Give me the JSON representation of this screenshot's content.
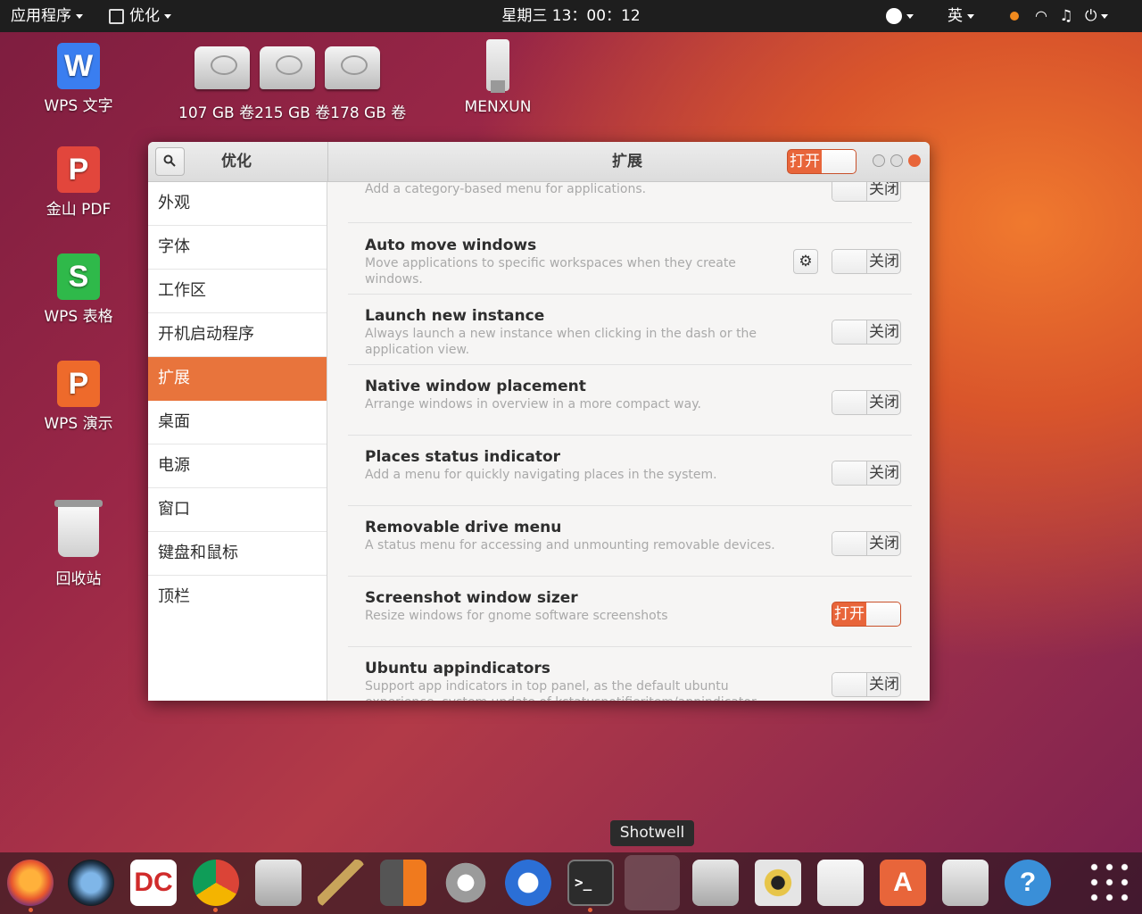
{
  "topbar": {
    "apps_menu": "应用程序",
    "active_app": "优化",
    "clock": "星期三 13：00：12",
    "input_method": "英"
  },
  "desktop": {
    "wps_writer": "WPS 文字",
    "pdf": "金山 PDF",
    "wps_sheets": "WPS 表格",
    "wps_present": "WPS 演示",
    "trash": "回收站",
    "drives": "107 GB 卷215 GB 卷178 GB 卷",
    "usb": "MENXUN"
  },
  "window": {
    "sidebar_title": "优化",
    "page_title": "扩展",
    "master_switch": "打开",
    "sidebar_items": [
      "外观",
      "字体",
      "工作区",
      "开机启动程序",
      "扩展",
      "桌面",
      "电源",
      "窗口",
      "键盘和鼠标",
      "顶栏"
    ],
    "extensions": [
      {
        "title": "",
        "desc": "Add a category-based menu for applications.",
        "state": "关闭",
        "on": false
      },
      {
        "title": "Auto move windows",
        "desc": "Move applications to specific workspaces when they create windows.",
        "state": "关闭",
        "on": false
      },
      {
        "title": "Launch new instance",
        "desc": "Always launch a new instance when clicking in the dash or the application view.",
        "state": "关闭",
        "on": false
      },
      {
        "title": "Native window placement",
        "desc": "Arrange windows in overview in a more compact way.",
        "state": "关闭",
        "on": false
      },
      {
        "title": "Places status indicator",
        "desc": "Add a menu for quickly navigating places in the system.",
        "state": "关闭",
        "on": false
      },
      {
        "title": "Removable drive menu",
        "desc": "A status menu for accessing and unmounting removable devices.",
        "state": "关闭",
        "on": false
      },
      {
        "title": "Screenshot window sizer",
        "desc": "Resize windows for gnome software screenshots",
        "state": "打开",
        "on": true
      },
      {
        "title": "Ubuntu appindicators",
        "desc": "Support app indicators in top panel, as the default ubuntu experience. system update of kstatusnotifieritem/appindicator extension",
        "state": "关闭",
        "on": false
      }
    ]
  },
  "dock": {
    "tooltip": "Shotwell"
  },
  "colors": {
    "accent": "#e8653a",
    "selected": "#e8743c"
  }
}
